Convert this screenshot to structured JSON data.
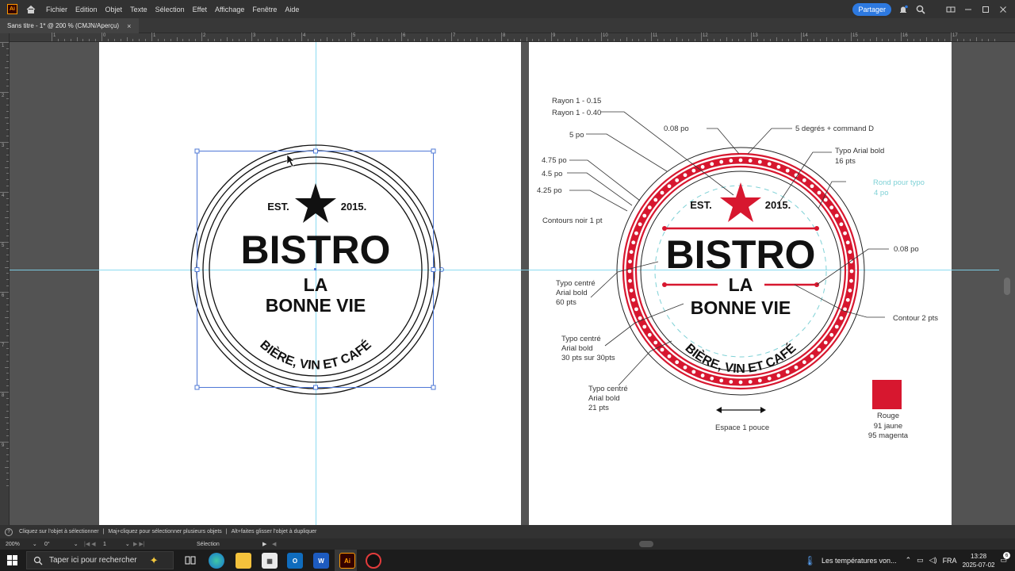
{
  "menu": {
    "app_logo": "Ai",
    "items": [
      "Fichier",
      "Edition",
      "Objet",
      "Texte",
      "Sélection",
      "Effet",
      "Affichage",
      "Fenêtre",
      "Aide"
    ],
    "share_label": "Partager"
  },
  "document_tab": {
    "title": "Sans titre - 1* @ 200 % (CMJN/Aperçu)",
    "close": "×"
  },
  "ruler": {
    "top_labels": [
      "1",
      "0",
      "1",
      "2",
      "3",
      "4",
      "5",
      "6",
      "7",
      "8",
      "9",
      "10",
      "11",
      "12",
      "13",
      "14",
      "15",
      "16",
      "17"
    ],
    "left_labels": [
      "1",
      "2",
      "3",
      "4",
      "5",
      "6",
      "7",
      "8",
      "9"
    ]
  },
  "left_logo": {
    "est_left": "EST.",
    "est_right": "2015.",
    "name": "BISTRO",
    "line2": "LA",
    "line3": "BONNE VIE",
    "arc_text": "BIÈRE, VIN ET CAFÉ"
  },
  "right_logo": {
    "est_left": "EST.",
    "est_right": "2015.",
    "name": "BISTRO",
    "line2": "LA",
    "line3": "BONNE VIE",
    "arc_text": "BIÈRE, VIN ET CAFÉ",
    "accent_color": "#d7172f",
    "guide_color": "#7fd1d6"
  },
  "annotations": {
    "rayon1": "Rayon 1 - 0.15",
    "rayon2": "Rayon 1 - 0.40",
    "po5": "5 po",
    "po475": "4.75 po",
    "po45": "4.5 po",
    "po425": "4.25 po",
    "contours": "Contours noir 1 pt",
    "po008_top": "0.08 po",
    "degres": "5 degrés + command D",
    "typo_arial": [
      "Typo Arial bold",
      "16 pts"
    ],
    "rond": [
      "Rond pour typo",
      "4 po"
    ],
    "po008_right": "0.08 po",
    "contour2": "Contour 2 pts",
    "typo60": [
      "Typo centré",
      "Arial bold",
      "60 pts"
    ],
    "typo30": [
      "Typo centré",
      "Arial bold",
      "30 pts sur 30pts"
    ],
    "typo21": [
      "Typo centré",
      "Arial bold",
      "21 pts"
    ],
    "espace": "Espace 1 pouce",
    "rouge": [
      "Rouge",
      "91 jaune",
      "95 magenta"
    ]
  },
  "status": {
    "hint1": "Cliquez sur l'objet à sélectionner",
    "hint2": "Maj+cliquez pour sélectionner plusieurs objets",
    "hint3": "Alt+faites glisser l'objet à dupliquer"
  },
  "controls": {
    "zoom": "200%",
    "angle": "0°",
    "artboard_num": "1",
    "tool": "Sélection"
  },
  "taskbar": {
    "search_placeholder": "Taper ici pour rechercher",
    "weather": "Les températures von...",
    "lang": "FRA",
    "time": "13:28",
    "date": "2025-07-02",
    "notification_count": "6"
  }
}
